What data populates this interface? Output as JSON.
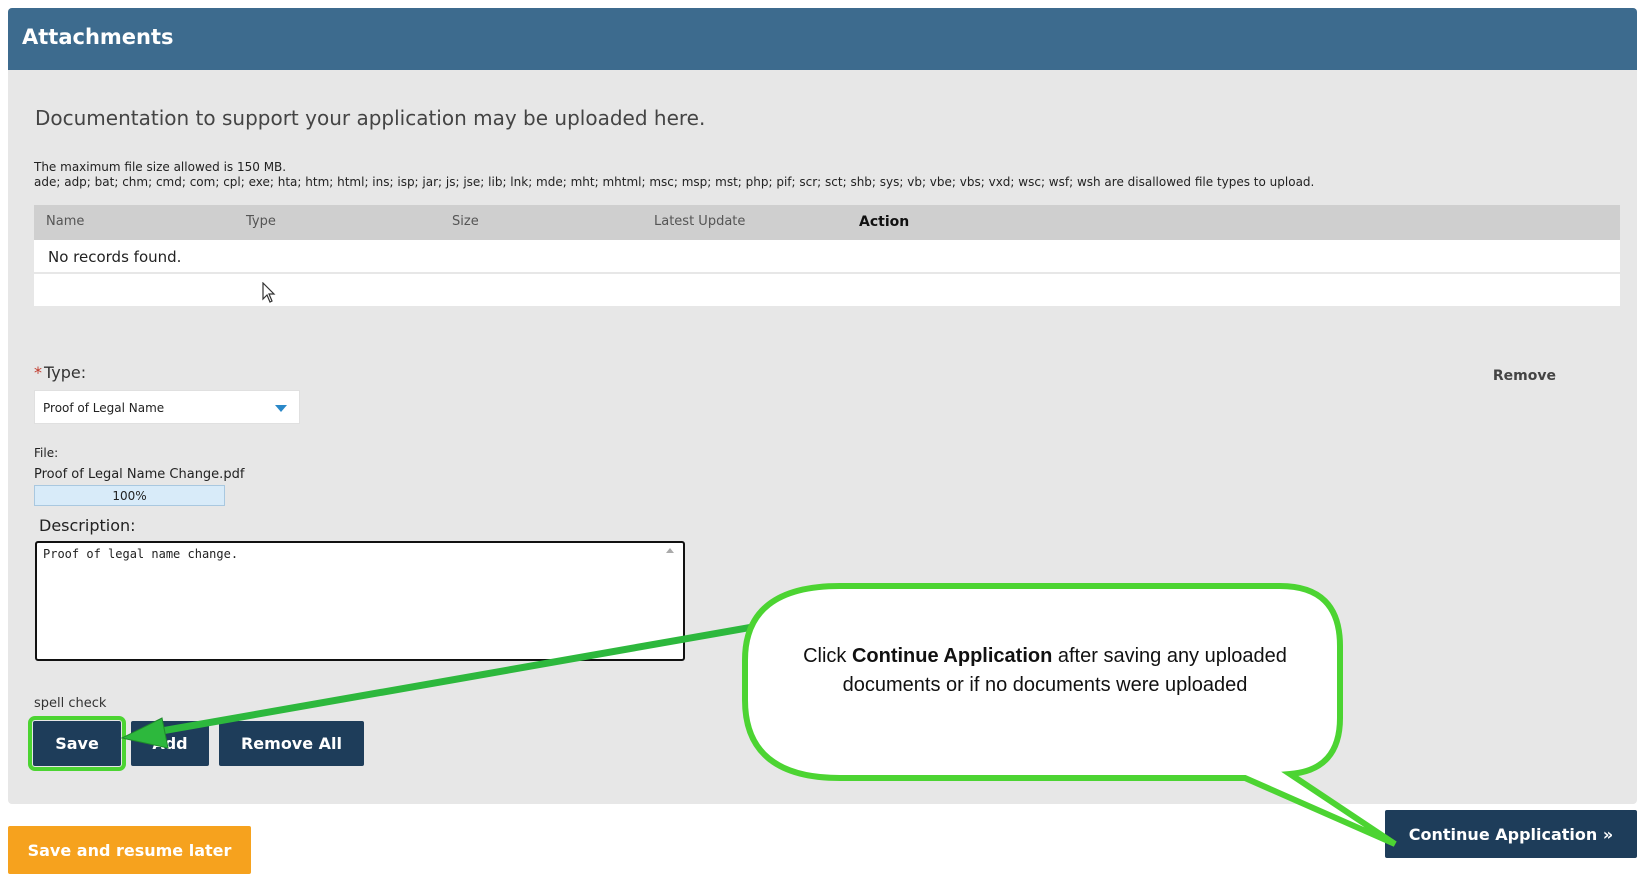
{
  "panel": {
    "title": "Attachments",
    "intro": "Documentation to support your application may be uploaded here.",
    "max_size_text": "The maximum file size allowed is 150 MB.",
    "disallowed_text": "ade; adp; bat; chm; cmd; com; cpl; exe; hta; htm; html; ins; isp; jar; js; jse; lib; lnk; mde; mht; mhtml; msc; msp; mst; php; pif; scr; sct; shb; sys; vb; vbe; vbs; vxd; wsc; wsf; wsh are disallowed file types to upload."
  },
  "table": {
    "columns": [
      "Name",
      "Type",
      "Size",
      "Latest Update",
      "Action"
    ],
    "empty_text": "No records found."
  },
  "form": {
    "type_label": "Type:",
    "required_marker": "*",
    "type_value": "Proof of Legal Name",
    "remove_label": "Remove",
    "file_label": "File:",
    "file_name": "Proof of Legal Name Change.pdf",
    "progress_text": "100%",
    "progress_fraction": 1.0,
    "description_label": "Description:",
    "description_value": "Proof of legal name change.",
    "spell_check_label": "spell check"
  },
  "buttons": {
    "save": "Save",
    "add": "Add",
    "remove_all": "Remove All",
    "save_resume": "Save and resume later",
    "continue": "Continue Application »"
  },
  "callout": {
    "prefix": "Click ",
    "bold": "Continue Application",
    "suffix": " after saving any uploaded documents or if no documents were uploaded"
  },
  "colors": {
    "header": "#3d6b8e",
    "primary_button": "#1e3d5a",
    "secondary_button": "#f6a21e",
    "highlight": "#4cd432"
  }
}
